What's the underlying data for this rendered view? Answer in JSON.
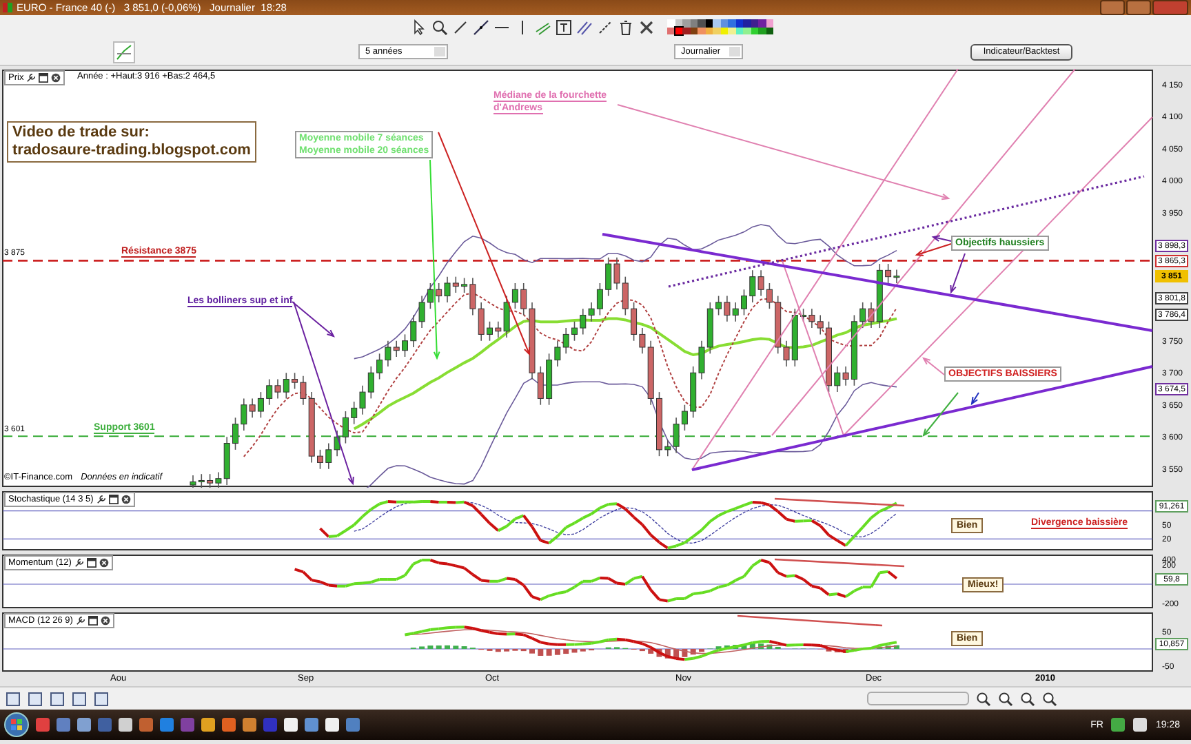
{
  "window": {
    "title": "EURO - France 40 (-)   3 851,0 (-0,06%)   Journalier  18:28"
  },
  "palette": [
    {
      "color": "#ffffff",
      "selected": false
    },
    {
      "color": "#c8c8c8",
      "selected": false
    },
    {
      "color": "#a0a0a0",
      "selected": false
    },
    {
      "color": "#808080",
      "selected": false
    },
    {
      "color": "#505050",
      "selected": false
    },
    {
      "color": "#000000",
      "selected": false
    },
    {
      "color": "#a8c8f0",
      "selected": false
    },
    {
      "color": "#6090e0",
      "selected": false
    },
    {
      "color": "#3070e0",
      "selected": false
    },
    {
      "color": "#1030d0",
      "selected": false
    },
    {
      "color": "#2020a0",
      "selected": false
    },
    {
      "color": "#402090",
      "selected": false
    },
    {
      "color": "#7020a0",
      "selected": false
    },
    {
      "color": "#f0a0d0",
      "selected": false
    },
    {
      "color": "#e07070",
      "selected": false
    },
    {
      "color": "#ff0000",
      "selected": true
    },
    {
      "color": "#a02020",
      "selected": false
    },
    {
      "color": "#804010",
      "selected": false
    },
    {
      "color": "#f09060",
      "selected": false
    },
    {
      "color": "#f0b040",
      "selected": false
    },
    {
      "color": "#f0d060",
      "selected": false
    },
    {
      "color": "#f0f000",
      "selected": false
    },
    {
      "color": "#f0f090",
      "selected": false
    },
    {
      "color": "#60f0c0",
      "selected": false
    },
    {
      "color": "#90f090",
      "selected": false
    },
    {
      "color": "#30d030",
      "selected": false
    },
    {
      "color": "#20a020",
      "selected": false
    },
    {
      "color": "#106010",
      "selected": false
    }
  ],
  "period_select": {
    "value": "5 années"
  },
  "interval_select": {
    "value": "Journalier"
  },
  "indicator_button": {
    "label": "Indicateur/Backtest"
  },
  "price_pane": {
    "title": "Prix",
    "info": "Année : +Haut:3 916 +Bas:2 464,5",
    "copyright": "©IT-Finance.com",
    "disclaimer": "Données en indicatif",
    "level_labels": [
      "3 875",
      "3 601"
    ],
    "price_tags": [
      {
        "text": "3 898,3",
        "kind": "outline",
        "color": "#7030a0"
      },
      {
        "text": "3 865,3",
        "kind": "outline",
        "color": "#d03030"
      },
      {
        "text": "3 851",
        "kind": "current",
        "color": "#f0c000"
      },
      {
        "text": "3 801,8",
        "kind": "outline",
        "color": "#404040"
      },
      {
        "text": "3 786,4",
        "kind": "outline",
        "color": "#404040"
      },
      {
        "text": "3 674,5",
        "kind": "outline",
        "color": "#7030a0"
      }
    ],
    "annotations": [
      {
        "kind": "banner",
        "lines": [
          "Video de trade sur:",
          "tradosaure-trading.blogspot.com"
        ],
        "color": "#5a3a10"
      },
      {
        "kind": "boxed",
        "lines": [
          "Moyenne mobile 7 séances",
          "Moyenne mobile 20 séances"
        ],
        "color": "#70e070"
      },
      {
        "kind": "underlined",
        "lines": [
          "Médiane de la fourchette",
          "d'Andrews"
        ],
        "color": "#e070b0"
      },
      {
        "kind": "underlined",
        "lines": [
          "Résistance 3875"
        ],
        "color": "#c02020"
      },
      {
        "kind": "underlined",
        "lines": [
          "Les bolliners sup et inf"
        ],
        "color": "#6020a0"
      },
      {
        "kind": "underlined",
        "lines": [
          "Support 3601"
        ],
        "color": "#40b040"
      },
      {
        "kind": "boxed",
        "lines": [
          "Objectifs haussiers"
        ],
        "color": "#208020"
      },
      {
        "kind": "boxed",
        "lines": [
          "OBJECTIFS BAISSIERS"
        ],
        "color": "#d02020"
      }
    ],
    "y_axis_labels": [
      "4 150",
      "4 100",
      "4 050",
      "4 000",
      "3 950",
      "3 750",
      "3 700",
      "3 650",
      "3 600",
      "3 550"
    ]
  },
  "indicator_panes": [
    {
      "kind": "stochastic",
      "title": "Stochastique (14 3 5)",
      "ticks": [
        "50",
        "20"
      ],
      "value_tag": "91,261",
      "notes": [
        {
          "text": "Bien",
          "kind": "boxed"
        },
        {
          "text": "Divergence baissière",
          "kind": "underlined"
        }
      ]
    },
    {
      "kind": "momentum",
      "title": "Momentum (12)",
      "ticks": [
        "400",
        "200",
        "-200"
      ],
      "value_tag": "59,8",
      "notes": [
        {
          "text": "Mieux!",
          "kind": "boxed"
        }
      ]
    },
    {
      "kind": "macd",
      "title": "MACD (12 26 9)",
      "ticks": [
        "50",
        "-50"
      ],
      "value_tag": "10,857",
      "notes": [
        {
          "text": "Bien",
          "kind": "boxed"
        }
      ]
    }
  ],
  "time_axis": [
    {
      "label": "Aou",
      "kind": "month"
    },
    {
      "label": "Sep",
      "kind": "month"
    },
    {
      "label": "Oct",
      "kind": "month"
    },
    {
      "label": "Nov",
      "kind": "month"
    },
    {
      "label": "Dec",
      "kind": "month"
    },
    {
      "label": "2010",
      "kind": "year"
    }
  ],
  "taskbar": {
    "language": "FR",
    "clock": "19:28"
  }
}
